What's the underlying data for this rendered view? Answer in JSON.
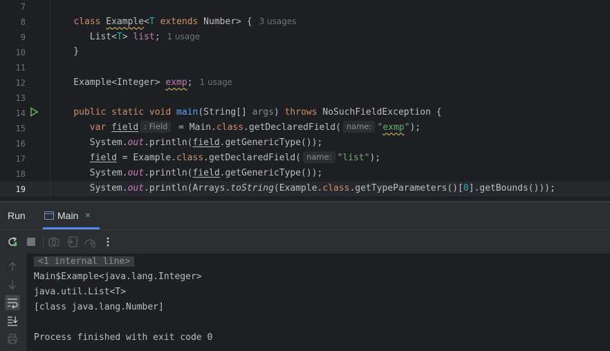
{
  "editor": {
    "line_numbers": [
      "7",
      "8",
      "9",
      "10",
      "11",
      "12",
      "13",
      "14",
      "15",
      "16",
      "17",
      "18",
      "19"
    ],
    "usages": {
      "class_example": "3 usages",
      "list_field": "1 usage",
      "exmp_field": "1 usage"
    },
    "inlay": {
      "field_type": ": Field",
      "name_param_1": "name:",
      "name_param_2": "name:"
    }
  },
  "run_panel": {
    "title": "Run",
    "tab_label": "Main",
    "tab_close": "×"
  },
  "console": {
    "lines": [
      "<1 internal line>",
      "Main$Example<java.lang.Integer>",
      "java.util.List<T>",
      "[class java.lang.Number]",
      "",
      "Process finished with exit code 0"
    ]
  },
  "icons": {
    "toolbar": [
      "rerun-icon",
      "stop-icon",
      "camera-icon",
      "restore-layout-icon",
      "dump-threads-icon",
      "more-icon"
    ],
    "side": [
      "up-arrow-icon",
      "down-arrow-icon",
      "soft-wrap-icon",
      "scroll-to-end-icon",
      "print-icon"
    ]
  },
  "colors": {
    "background": "#1e1f22",
    "keyword": "#cf8e6d",
    "type_param": "#16baac",
    "field": "#c77dbb",
    "method": "#56a8f5",
    "string": "#6aab73",
    "accent": "#548af7",
    "run_green": "#5fb865"
  }
}
